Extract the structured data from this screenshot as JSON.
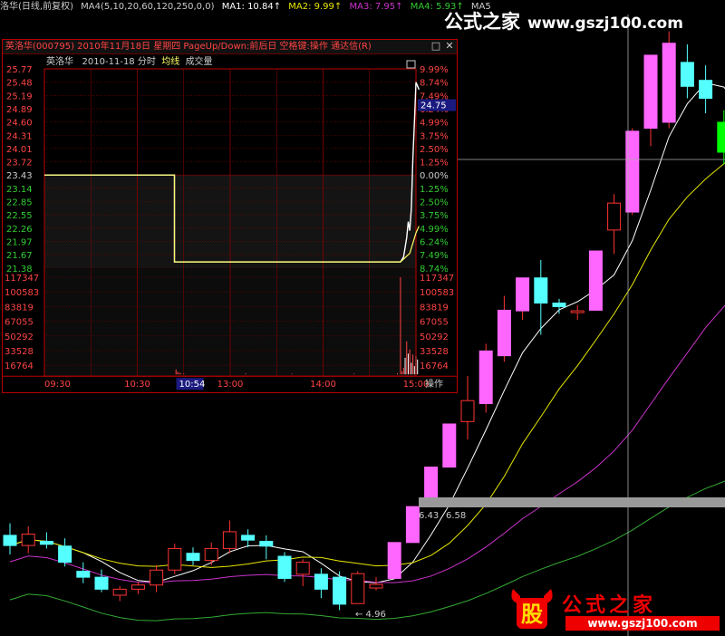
{
  "topbar": {
    "stock_label": "洛华(日线,前复权)",
    "ma4_label": "MA4(5,10,20,60,120,250,0,0)",
    "ma1": "MA1: 10.84↑",
    "ma2": "MA2: 9.99↑",
    "ma3": "MA3: 7.95↑",
    "ma4": "MA4: 5.93↑",
    "ma5": "MA5"
  },
  "colors": {
    "up": "#ff3333",
    "up_fill": "#ff66ff",
    "down": "#55ffff",
    "down_green": "#00ff00",
    "ma1": "#ffffff",
    "ma2": "#e6e600",
    "ma3": "#cc33cc",
    "ma4": "#33aa33",
    "grid": "#8b0000",
    "avg_line": "#ffff66"
  },
  "candles": [
    {
      "o": 6.1,
      "h": 6.3,
      "l": 5.78,
      "c": 5.93
    },
    {
      "o": 5.93,
      "h": 6.25,
      "l": 5.8,
      "c": 6.12
    },
    {
      "o": 6.0,
      "h": 6.15,
      "l": 5.88,
      "c": 5.95
    },
    {
      "o": 5.92,
      "h": 6.05,
      "l": 5.58,
      "c": 5.65
    },
    {
      "o": 5.5,
      "h": 5.65,
      "l": 5.3,
      "c": 5.4
    },
    {
      "o": 5.4,
      "h": 5.53,
      "l": 5.15,
      "c": 5.2
    },
    {
      "o": 5.1,
      "h": 5.25,
      "l": 5.0,
      "c": 5.2
    },
    {
      "o": 5.2,
      "h": 5.32,
      "l": 5.12,
      "c": 5.27
    },
    {
      "o": 5.27,
      "h": 5.6,
      "l": 5.15,
      "c": 5.52
    },
    {
      "o": 5.52,
      "h": 5.96,
      "l": 5.45,
      "c": 5.88
    },
    {
      "o": 5.8,
      "h": 5.9,
      "l": 5.6,
      "c": 5.68
    },
    {
      "o": 5.68,
      "h": 5.98,
      "l": 5.6,
      "c": 5.88
    },
    {
      "o": 5.88,
      "h": 6.35,
      "l": 5.8,
      "c": 6.16
    },
    {
      "o": 6.1,
      "h": 6.2,
      "l": 5.9,
      "c": 6.02
    },
    {
      "o": 6.0,
      "h": 6.1,
      "l": 5.7,
      "c": 5.92
    },
    {
      "o": 5.75,
      "h": 5.82,
      "l": 5.32,
      "c": 5.38
    },
    {
      "o": 5.45,
      "h": 5.7,
      "l": 5.25,
      "c": 5.65
    },
    {
      "o": 5.45,
      "h": 5.55,
      "l": 5.05,
      "c": 5.2
    },
    {
      "o": 5.4,
      "h": 5.5,
      "l": 4.85,
      "c": 4.95
    },
    {
      "o": 4.96,
      "h": 5.5,
      "l": 4.96,
      "c": 5.46
    },
    {
      "o": 5.22,
      "h": 5.4,
      "l": 5.18,
      "c": 5.28
    },
    {
      "o": 5.38,
      "h": 5.98,
      "l": 5.38,
      "c": 5.98
    },
    {
      "o": 5.98,
      "h": 6.58,
      "l": 5.98,
      "c": 6.58
    },
    {
      "o": 6.58,
      "h": 7.24,
      "l": 6.58,
      "c": 7.24
    },
    {
      "o": 7.24,
      "h": 7.96,
      "l": 7.24,
      "c": 7.96
    },
    {
      "o": 8.0,
      "h": 8.76,
      "l": 7.7,
      "c": 8.35
    },
    {
      "o": 8.3,
      "h": 9.3,
      "l": 8.15,
      "c": 9.18
    },
    {
      "o": 9.1,
      "h": 10.1,
      "l": 9.0,
      "c": 9.86
    },
    {
      "o": 9.85,
      "h": 10.4,
      "l": 9.7,
      "c": 10.4
    },
    {
      "o": 10.4,
      "h": 10.7,
      "l": 9.45,
      "c": 9.98
    },
    {
      "o": 9.98,
      "h": 10.05,
      "l": 9.8,
      "c": 9.92
    },
    {
      "o": 9.82,
      "h": 9.95,
      "l": 9.7,
      "c": 9.85
    },
    {
      "o": 9.86,
      "h": 10.85,
      "l": 9.86,
      "c": 10.85
    },
    {
      "o": 11.2,
      "h": 11.8,
      "l": 10.8,
      "c": 11.65
    },
    {
      "o": 11.5,
      "h": 12.9,
      "l": 11.45,
      "c": 12.85
    },
    {
      "o": 12.9,
      "h": 14.12,
      "l": 12.6,
      "c": 14.12
    },
    {
      "o": 13.0,
      "h": 14.52,
      "l": 12.9,
      "c": 14.32
    },
    {
      "o": 14.0,
      "h": 14.3,
      "l": 13.4,
      "c": 13.6
    },
    {
      "o": 13.7,
      "h": 13.95,
      "l": 13.15,
      "c": 13.4
    },
    {
      "o": 13.0,
      "h": 13.2,
      "l": 12.3,
      "c": 12.5
    },
    {
      "o": 12.4,
      "h": 12.7,
      "l": 12.0,
      "c": 12.2
    }
  ],
  "annotations": {
    "low_price": "4.96",
    "price_a": "6.43",
    "price_b": "6.58"
  },
  "popup": {
    "title": "英洛华(000795)  2010年11月18日  星期四  PageUp/Down:前后日  空格键:操作  通达信(R)",
    "stock_name": "英洛华",
    "date_label": "2010-11-18 分时",
    "avg_label": "均线",
    "vol_label": "成交量",
    "price_ticks": [
      "25.77",
      "25.48",
      "25.19",
      "24.89",
      "24.60",
      "24.31",
      "24.01",
      "23.72",
      "23.43",
      "23.14",
      "22.85",
      "22.55",
      "22.26",
      "21.97",
      "21.67",
      "21.38"
    ],
    "pct_ticks": [
      "9.99%",
      "8.74%",
      "7.49%",
      "6.24%",
      "4.99%",
      "3.75%",
      "2.50%",
      "1.25%",
      "0.00%",
      "1.25%",
      "2.50%",
      "3.75%",
      "4.99%",
      "6.24%",
      "7.49%",
      "8.74%"
    ],
    "vol_ticks": [
      "117347",
      "100583",
      "83819",
      "67055",
      "50292",
      "33528",
      "16764"
    ],
    "time_ticks": [
      "09:30",
      "10:30",
      "13:00",
      "14:00",
      "15:00"
    ],
    "cursor_time": "10:54",
    "cursor_price": "24.75",
    "action_label": "操作"
  },
  "watermark": {
    "top_name": "公式之家",
    "top_url": "www.gszj100.com",
    "badge": "股",
    "bottom_name": "公式之家",
    "bottom_url": "www.gszj100.com"
  }
}
